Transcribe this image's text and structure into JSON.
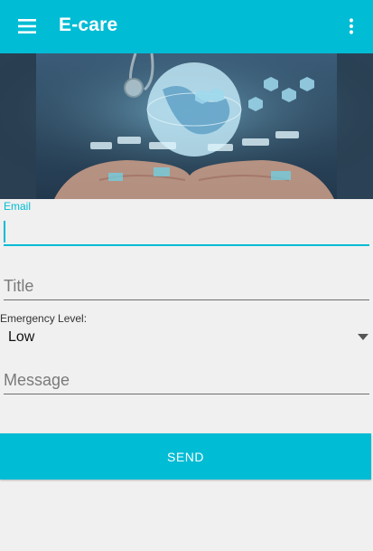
{
  "app": {
    "title": "E-care"
  },
  "icons": {
    "menu": "hamburger-menu-icon",
    "more": "overflow-more-icon"
  },
  "colors": {
    "accent": "#00bcd4",
    "background": "#f0f0f0",
    "text": "#111111",
    "hint": "#7a7a7a"
  },
  "form": {
    "email": {
      "label": "Email",
      "value": ""
    },
    "title": {
      "placeholder": "Title",
      "value": ""
    },
    "emergency": {
      "label": "Emergency Level:",
      "selected": "Low"
    },
    "message": {
      "placeholder": "Message",
      "value": ""
    },
    "send_label": "SEND"
  }
}
